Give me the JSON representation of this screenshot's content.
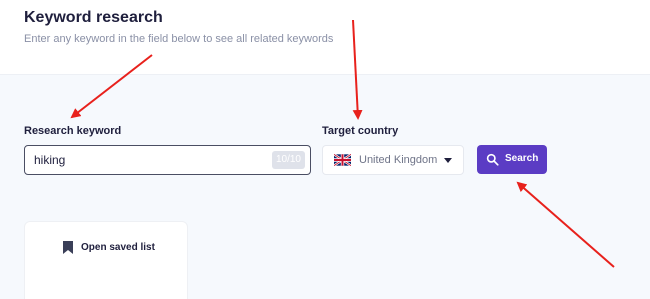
{
  "header": {
    "title": "Keyword research",
    "subtitle": "Enter any keyword in the field below to see all related keywords"
  },
  "keyword_field": {
    "label": "Research keyword",
    "value": "hiking",
    "counter": "10/10"
  },
  "country_field": {
    "label": "Target country",
    "value": "United Kingdom",
    "flag_icon": "uk-flag-icon"
  },
  "search_button": {
    "label": "Search",
    "icon": "search-icon",
    "color": "#5b3cc4"
  },
  "saved_list": {
    "label": "Open saved list",
    "icon": "bookmark-icon"
  },
  "annotations": {
    "arrow_color": "#e8211c"
  }
}
